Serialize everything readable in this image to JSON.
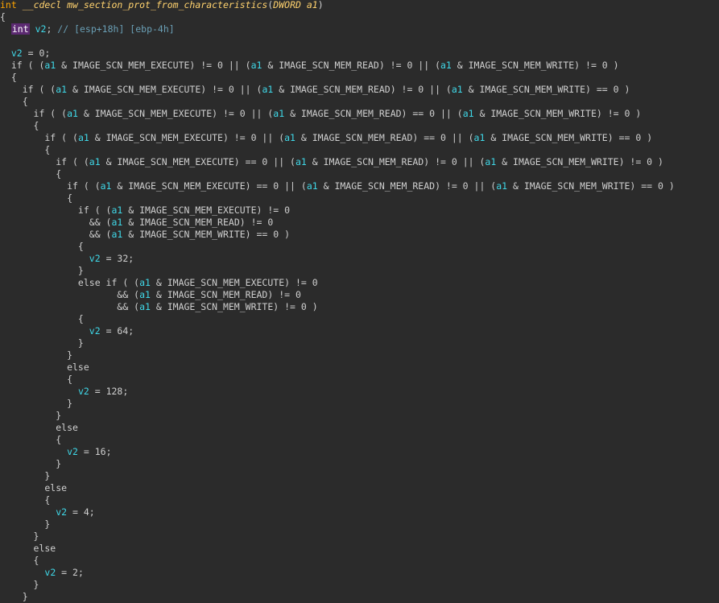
{
  "editor": {
    "theme_colors": {
      "background": "#2b2b2b",
      "keyword": "#ffa500",
      "variable": "#3fd8e8",
      "function": "#ffd26e",
      "type_highlight": "#5c2a72",
      "text": "#cfcfcf"
    },
    "lines": [
      [
        {
          "t": "int",
          "c": "kw"
        },
        {
          "t": " ",
          "c": "plain"
        },
        {
          "t": "__cdecl mw_section_prot_from_characteristics",
          "c": "func"
        },
        {
          "t": "(",
          "c": "plain"
        },
        {
          "t": "DWORD a1",
          "c": "func"
        },
        {
          "t": ")",
          "c": "plain"
        }
      ],
      [
        {
          "t": "{",
          "c": "plain"
        }
      ],
      [
        {
          "t": "  ",
          "c": "plain"
        },
        {
          "t": "int",
          "c": "type-hl"
        },
        {
          "t": " ",
          "c": "plain"
        },
        {
          "t": "v2",
          "c": "var"
        },
        {
          "t": "; ",
          "c": "plain"
        },
        {
          "t": "// [esp+18h] [ebp-4h]",
          "c": "comment"
        }
      ],
      [
        {
          "t": "",
          "c": "plain"
        }
      ],
      [
        {
          "t": "  ",
          "c": "plain"
        },
        {
          "t": "v2",
          "c": "var"
        },
        {
          "t": " = 0;",
          "c": "plain"
        }
      ],
      [
        {
          "t": "  if ( (",
          "c": "plain"
        },
        {
          "t": "a1",
          "c": "var"
        },
        {
          "t": " & IMAGE_SCN_MEM_EXECUTE) != 0 || (",
          "c": "plain"
        },
        {
          "t": "a1",
          "c": "var"
        },
        {
          "t": " & IMAGE_SCN_MEM_READ) != 0 || (",
          "c": "plain"
        },
        {
          "t": "a1",
          "c": "var"
        },
        {
          "t": " & IMAGE_SCN_MEM_WRITE) != 0 )",
          "c": "plain"
        }
      ],
      [
        {
          "t": "  {",
          "c": "plain"
        }
      ],
      [
        {
          "t": "    if ( (",
          "c": "plain"
        },
        {
          "t": "a1",
          "c": "var"
        },
        {
          "t": " & IMAGE_SCN_MEM_EXECUTE) != 0 || (",
          "c": "plain"
        },
        {
          "t": "a1",
          "c": "var"
        },
        {
          "t": " & IMAGE_SCN_MEM_READ) != 0 || (",
          "c": "plain"
        },
        {
          "t": "a1",
          "c": "var"
        },
        {
          "t": " & IMAGE_SCN_MEM_WRITE) == 0 )",
          "c": "plain"
        }
      ],
      [
        {
          "t": "    {",
          "c": "plain"
        }
      ],
      [
        {
          "t": "      if ( (",
          "c": "plain"
        },
        {
          "t": "a1",
          "c": "var"
        },
        {
          "t": " & IMAGE_SCN_MEM_EXECUTE) != 0 || (",
          "c": "plain"
        },
        {
          "t": "a1",
          "c": "var"
        },
        {
          "t": " & IMAGE_SCN_MEM_READ) == 0 || (",
          "c": "plain"
        },
        {
          "t": "a1",
          "c": "var"
        },
        {
          "t": " & IMAGE_SCN_MEM_WRITE) != 0 )",
          "c": "plain"
        }
      ],
      [
        {
          "t": "      {",
          "c": "plain"
        }
      ],
      [
        {
          "t": "        if ( (",
          "c": "plain"
        },
        {
          "t": "a1",
          "c": "var"
        },
        {
          "t": " & IMAGE_SCN_MEM_EXECUTE) != 0 || (",
          "c": "plain"
        },
        {
          "t": "a1",
          "c": "var"
        },
        {
          "t": " & IMAGE_SCN_MEM_READ) == 0 || (",
          "c": "plain"
        },
        {
          "t": "a1",
          "c": "var"
        },
        {
          "t": " & IMAGE_SCN_MEM_WRITE) == 0 )",
          "c": "plain"
        }
      ],
      [
        {
          "t": "        {",
          "c": "plain"
        }
      ],
      [
        {
          "t": "          if ( (",
          "c": "plain"
        },
        {
          "t": "a1",
          "c": "var"
        },
        {
          "t": " & IMAGE_SCN_MEM_EXECUTE) == 0 || (",
          "c": "plain"
        },
        {
          "t": "a1",
          "c": "var"
        },
        {
          "t": " & IMAGE_SCN_MEM_READ) != 0 || (",
          "c": "plain"
        },
        {
          "t": "a1",
          "c": "var"
        },
        {
          "t": " & IMAGE_SCN_MEM_WRITE) != 0 )",
          "c": "plain"
        }
      ],
      [
        {
          "t": "          {",
          "c": "plain"
        }
      ],
      [
        {
          "t": "            if ( (",
          "c": "plain"
        },
        {
          "t": "a1",
          "c": "var"
        },
        {
          "t": " & IMAGE_SCN_MEM_EXECUTE) == 0 || (",
          "c": "plain"
        },
        {
          "t": "a1",
          "c": "var"
        },
        {
          "t": " & IMAGE_SCN_MEM_READ) != 0 || (",
          "c": "plain"
        },
        {
          "t": "a1",
          "c": "var"
        },
        {
          "t": " & IMAGE_SCN_MEM_WRITE) == 0 )",
          "c": "plain"
        }
      ],
      [
        {
          "t": "            {",
          "c": "plain"
        }
      ],
      [
        {
          "t": "              if ( (",
          "c": "plain"
        },
        {
          "t": "a1",
          "c": "var"
        },
        {
          "t": " & IMAGE_SCN_MEM_EXECUTE) != 0",
          "c": "plain"
        }
      ],
      [
        {
          "t": "                && (",
          "c": "plain"
        },
        {
          "t": "a1",
          "c": "var"
        },
        {
          "t": " & IMAGE_SCN_MEM_READ) != 0",
          "c": "plain"
        }
      ],
      [
        {
          "t": "                && (",
          "c": "plain"
        },
        {
          "t": "a1",
          "c": "var"
        },
        {
          "t": " & IMAGE_SCN_MEM_WRITE) == 0 )",
          "c": "plain"
        }
      ],
      [
        {
          "t": "              {",
          "c": "plain"
        }
      ],
      [
        {
          "t": "                ",
          "c": "plain"
        },
        {
          "t": "v2",
          "c": "var"
        },
        {
          "t": " = 32;",
          "c": "plain"
        }
      ],
      [
        {
          "t": "              }",
          "c": "plain"
        }
      ],
      [
        {
          "t": "              else if ( (",
          "c": "plain"
        },
        {
          "t": "a1",
          "c": "var"
        },
        {
          "t": " & IMAGE_SCN_MEM_EXECUTE) != 0",
          "c": "plain"
        }
      ],
      [
        {
          "t": "                     && (",
          "c": "plain"
        },
        {
          "t": "a1",
          "c": "var"
        },
        {
          "t": " & IMAGE_SCN_MEM_READ) != 0",
          "c": "plain"
        }
      ],
      [
        {
          "t": "                     && (",
          "c": "plain"
        },
        {
          "t": "a1",
          "c": "var"
        },
        {
          "t": " & IMAGE_SCN_MEM_WRITE) != 0 )",
          "c": "plain"
        }
      ],
      [
        {
          "t": "              {",
          "c": "plain"
        }
      ],
      [
        {
          "t": "                ",
          "c": "plain"
        },
        {
          "t": "v2",
          "c": "var"
        },
        {
          "t": " = 64;",
          "c": "plain"
        }
      ],
      [
        {
          "t": "              }",
          "c": "plain"
        }
      ],
      [
        {
          "t": "            }",
          "c": "plain"
        }
      ],
      [
        {
          "t": "            else",
          "c": "plain"
        }
      ],
      [
        {
          "t": "            {",
          "c": "plain"
        }
      ],
      [
        {
          "t": "              ",
          "c": "plain"
        },
        {
          "t": "v2",
          "c": "var"
        },
        {
          "t": " = 128;",
          "c": "plain"
        }
      ],
      [
        {
          "t": "            }",
          "c": "plain"
        }
      ],
      [
        {
          "t": "          }",
          "c": "plain"
        }
      ],
      [
        {
          "t": "          else",
          "c": "plain"
        }
      ],
      [
        {
          "t": "          {",
          "c": "plain"
        }
      ],
      [
        {
          "t": "            ",
          "c": "plain"
        },
        {
          "t": "v2",
          "c": "var"
        },
        {
          "t": " = 16;",
          "c": "plain"
        }
      ],
      [
        {
          "t": "          }",
          "c": "plain"
        }
      ],
      [
        {
          "t": "        }",
          "c": "plain"
        }
      ],
      [
        {
          "t": "        else",
          "c": "plain"
        }
      ],
      [
        {
          "t": "        {",
          "c": "plain"
        }
      ],
      [
        {
          "t": "          ",
          "c": "plain"
        },
        {
          "t": "v2",
          "c": "var"
        },
        {
          "t": " = 4;",
          "c": "plain"
        }
      ],
      [
        {
          "t": "        }",
          "c": "plain"
        }
      ],
      [
        {
          "t": "      }",
          "c": "plain"
        }
      ],
      [
        {
          "t": "      else",
          "c": "plain"
        }
      ],
      [
        {
          "t": "      {",
          "c": "plain"
        }
      ],
      [
        {
          "t": "        ",
          "c": "plain"
        },
        {
          "t": "v2",
          "c": "var"
        },
        {
          "t": " = 2;",
          "c": "plain"
        }
      ],
      [
        {
          "t": "      }",
          "c": "plain"
        }
      ],
      [
        {
          "t": "    }",
          "c": "plain"
        }
      ]
    ]
  }
}
